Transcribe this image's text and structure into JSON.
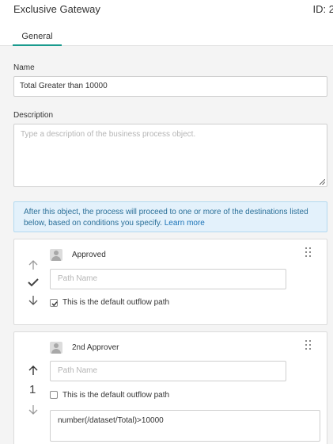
{
  "header": {
    "title": "Exclusive Gateway",
    "id_label": "ID: 2"
  },
  "tabs": [
    {
      "label": "General"
    }
  ],
  "name_field": {
    "label": "Name",
    "value": "Total Greater than 10000"
  },
  "description_field": {
    "label": "Description",
    "placeholder": "Type a description of the business process object."
  },
  "info": {
    "text": "After this object, the process will proceed to one or more of the destinations listed below, based on conditions you specify. ",
    "link_label": "Learn more"
  },
  "destinations": [
    {
      "name": "Approved",
      "path_placeholder": "Path Name",
      "default_label": "This is the default outflow path",
      "is_default": true,
      "avatar_icon": "user-icon",
      "marker_icon": "check-icon"
    },
    {
      "name": "2nd Approver",
      "path_placeholder": "Path Name",
      "default_label": "This is the default outflow path",
      "is_default": false,
      "order": "1",
      "condition": "number(/dataset/Total)>10000",
      "avatar_icon": "user-icon"
    }
  ],
  "colors": {
    "tab_underline": "#1a9b8e",
    "info_bg": "#e3f1fb",
    "info_text": "#2a6f98",
    "link": "#1a73b7"
  }
}
